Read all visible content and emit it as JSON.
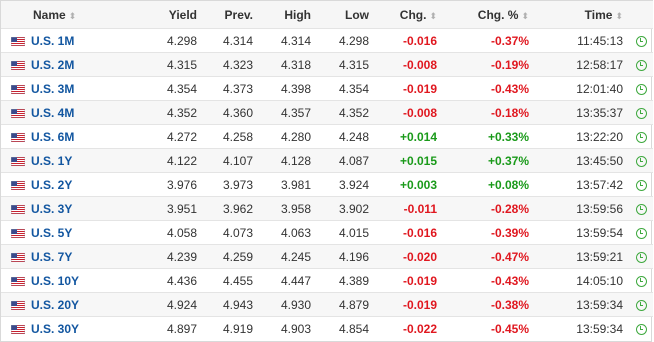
{
  "header": {
    "name": "Name",
    "yield": "Yield",
    "prev": "Prev.",
    "high": "High",
    "low": "Low",
    "chg": "Chg.",
    "chg_pct": "Chg. %",
    "time": "Time",
    "sort_icon": "⬍"
  },
  "colors": {
    "negative": "#e0171f",
    "positive": "#1a9a1a",
    "link": "#1256a0",
    "clock": "#3fa93f"
  },
  "rows": [
    {
      "name": "U.S. 1M",
      "yield": "4.298",
      "prev": "4.314",
      "high": "4.314",
      "low": "4.298",
      "chg": "-0.016",
      "chg_pct": "-0.37%",
      "time": "11:45:13",
      "dir": "neg"
    },
    {
      "name": "U.S. 2M",
      "yield": "4.315",
      "prev": "4.323",
      "high": "4.318",
      "low": "4.315",
      "chg": "-0.008",
      "chg_pct": "-0.19%",
      "time": "12:58:17",
      "dir": "neg"
    },
    {
      "name": "U.S. 3M",
      "yield": "4.354",
      "prev": "4.373",
      "high": "4.398",
      "low": "4.354",
      "chg": "-0.019",
      "chg_pct": "-0.43%",
      "time": "12:01:40",
      "dir": "neg"
    },
    {
      "name": "U.S. 4M",
      "yield": "4.352",
      "prev": "4.360",
      "high": "4.357",
      "low": "4.352",
      "chg": "-0.008",
      "chg_pct": "-0.18%",
      "time": "13:35:37",
      "dir": "neg"
    },
    {
      "name": "U.S. 6M",
      "yield": "4.272",
      "prev": "4.258",
      "high": "4.280",
      "low": "4.248",
      "chg": "+0.014",
      "chg_pct": "+0.33%",
      "time": "13:22:20",
      "dir": "pos"
    },
    {
      "name": "U.S. 1Y",
      "yield": "4.122",
      "prev": "4.107",
      "high": "4.128",
      "low": "4.087",
      "chg": "+0.015",
      "chg_pct": "+0.37%",
      "time": "13:45:50",
      "dir": "pos"
    },
    {
      "name": "U.S. 2Y",
      "yield": "3.976",
      "prev": "3.973",
      "high": "3.981",
      "low": "3.924",
      "chg": "+0.003",
      "chg_pct": "+0.08%",
      "time": "13:57:42",
      "dir": "pos"
    },
    {
      "name": "U.S. 3Y",
      "yield": "3.951",
      "prev": "3.962",
      "high": "3.958",
      "low": "3.902",
      "chg": "-0.011",
      "chg_pct": "-0.28%",
      "time": "13:59:56",
      "dir": "neg"
    },
    {
      "name": "U.S. 5Y",
      "yield": "4.058",
      "prev": "4.073",
      "high": "4.063",
      "low": "4.015",
      "chg": "-0.016",
      "chg_pct": "-0.39%",
      "time": "13:59:54",
      "dir": "neg"
    },
    {
      "name": "U.S. 7Y",
      "yield": "4.239",
      "prev": "4.259",
      "high": "4.245",
      "low": "4.196",
      "chg": "-0.020",
      "chg_pct": "-0.47%",
      "time": "13:59:21",
      "dir": "neg"
    },
    {
      "name": "U.S. 10Y",
      "yield": "4.436",
      "prev": "4.455",
      "high": "4.447",
      "low": "4.389",
      "chg": "-0.019",
      "chg_pct": "-0.43%",
      "time": "14:05:10",
      "dir": "neg"
    },
    {
      "name": "U.S. 20Y",
      "yield": "4.924",
      "prev": "4.943",
      "high": "4.930",
      "low": "4.879",
      "chg": "-0.019",
      "chg_pct": "-0.38%",
      "time": "13:59:34",
      "dir": "neg"
    },
    {
      "name": "U.S. 30Y",
      "yield": "4.897",
      "prev": "4.919",
      "high": "4.903",
      "low": "4.854",
      "chg": "-0.022",
      "chg_pct": "-0.45%",
      "time": "13:59:34",
      "dir": "neg"
    }
  ]
}
